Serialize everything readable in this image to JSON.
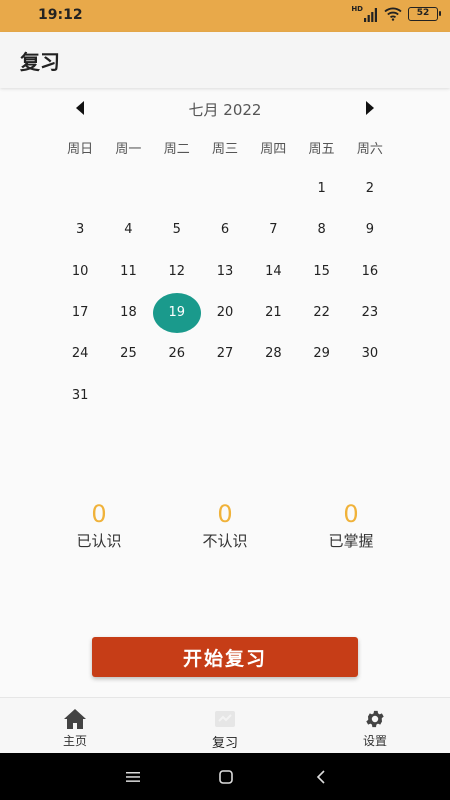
{
  "status_bar": {
    "time": "19:12",
    "battery": "52",
    "network_label": "HD"
  },
  "app_bar": {
    "title": "复习"
  },
  "calendar": {
    "month_label": "七月 2022",
    "weekdays": [
      "周日",
      "周一",
      "周二",
      "周三",
      "周四",
      "周五",
      "周六"
    ],
    "leading_blanks": 5,
    "days_in_month": 31,
    "selected_day": 19,
    "selected_color": "#1a9a8c"
  },
  "stats": [
    {
      "value": "0",
      "label": "已认识"
    },
    {
      "value": "0",
      "label": "不认识"
    },
    {
      "value": "0",
      "label": "已掌握"
    }
  ],
  "start_button": {
    "label": "开始复习",
    "color": "#c63d17"
  },
  "bottom_nav": [
    {
      "label": "主页",
      "icon": "home-icon"
    },
    {
      "label": "复习",
      "icon": "review-icon",
      "active": true
    },
    {
      "label": "设置",
      "icon": "gear-icon"
    }
  ],
  "colors": {
    "status_bar": "#e8a94a",
    "stat_value": "#f0b23a"
  }
}
